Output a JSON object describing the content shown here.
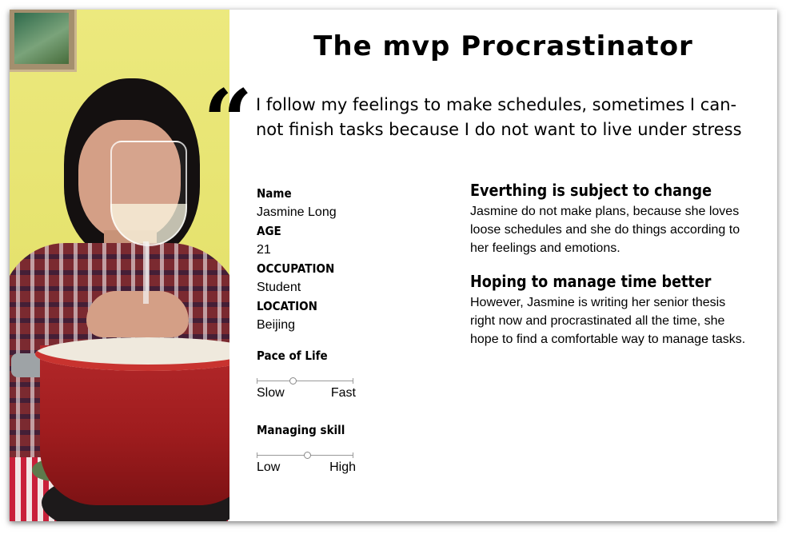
{
  "persona": {
    "title": "The mvp Procrastinator",
    "quote": "I follow my feelings to make schedules, sometimes I can-not finish tasks because I do not want to live under stress",
    "fields": [
      {
        "label": "Name",
        "value": "Jasmine Long"
      },
      {
        "label": "AGE",
        "value": "21"
      },
      {
        "label": "OCCUPATION",
        "value": "Student"
      },
      {
        "label": "LOCATION",
        "value": "Beijing"
      }
    ],
    "sliders": [
      {
        "label": "Pace of Life",
        "min_label": "Slow",
        "max_label": "Fast",
        "level": 0.37
      },
      {
        "label": "Managing skill",
        "min_label": "Low",
        "max_label": "High",
        "level": 0.52
      }
    ],
    "sections": [
      {
        "heading": "Everthing is subject to change",
        "body": "Jasmine do not make plans, because she loves loose schedules and she do things according to her feelings and emotions."
      },
      {
        "heading": "Hoping to manage time better",
        "body": "However, Jasmine is writing her senior thesis right now and procrastinated all the time, she hope to find a comfortable way to manage tasks."
      }
    ]
  }
}
